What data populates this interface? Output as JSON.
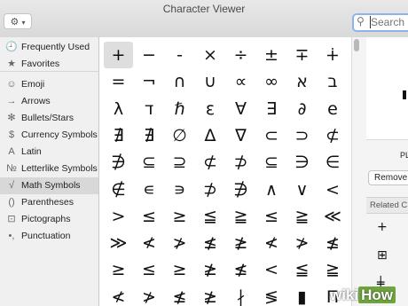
{
  "window": {
    "title": "Character Viewer"
  },
  "toolbar": {
    "gear_icon": "gear-icon",
    "search_placeholder": "Search"
  },
  "sidebar": {
    "items": [
      {
        "label": "Frequently Used",
        "icon": "🕘"
      },
      {
        "label": "Favorites",
        "icon": "★"
      },
      {
        "label": "Emoji",
        "icon": "☺"
      },
      {
        "label": "Arrows",
        "icon": "→"
      },
      {
        "label": "Bullets/Stars",
        "icon": "✻"
      },
      {
        "label": "Currency Symbols",
        "icon": "$"
      },
      {
        "label": "Latin",
        "icon": "A"
      },
      {
        "label": "Letterlike Symbols",
        "icon": "№"
      },
      {
        "label": "Math Symbols",
        "icon": "√"
      },
      {
        "label": "Parentheses",
        "icon": "()"
      },
      {
        "label": "Pictographs",
        "icon": "⊡"
      },
      {
        "label": "Punctuation",
        "icon": "•,"
      }
    ],
    "selected": "Math Symbols"
  },
  "grid": {
    "rows": [
      [
        "+",
        "−",
        "-",
        "×",
        "÷",
        "±",
        "∓",
        "∔"
      ],
      [
        "=",
        "¬",
        "∩",
        "∪",
        "∝",
        "∞",
        "א",
        "ב"
      ],
      [
        "λ",
        "ד",
        "ℏ",
        "ε",
        "∀",
        "∃",
        "∂",
        "e"
      ],
      [
        "∄",
        "∄",
        "∅",
        "∆",
        "∇",
        "⊂",
        "⊃",
        "⊄"
      ],
      [
        "∌",
        "⊆",
        "⊇",
        "⊄",
        "⊅",
        "⊆",
        "∋",
        "∈"
      ],
      [
        "∉",
        "∊",
        "∍",
        "⊅",
        "∌",
        "∧",
        "∨",
        "<"
      ],
      [
        ">",
        "≤",
        "≥",
        "≦",
        "≧",
        "≤",
        "≧",
        "≪"
      ],
      [
        "≫",
        "≮",
        "≯",
        "≰",
        "≱",
        "≮",
        "≯",
        "≰"
      ],
      [
        "≥",
        "≤",
        "≥",
        "≱",
        "≰",
        "<",
        "≦",
        "≧"
      ],
      [
        "≮",
        "≯",
        "≰",
        "≱",
        "∤",
        "≶",
        "▮",
        "Π"
      ]
    ],
    "selected": "+"
  },
  "detail": {
    "name_partial": "PL",
    "remove_label": "Remove",
    "related_label": "Related C",
    "related": [
      "+",
      "⊞",
      "╪"
    ]
  },
  "watermark": {
    "text1": "wiki",
    "text2": "How"
  }
}
